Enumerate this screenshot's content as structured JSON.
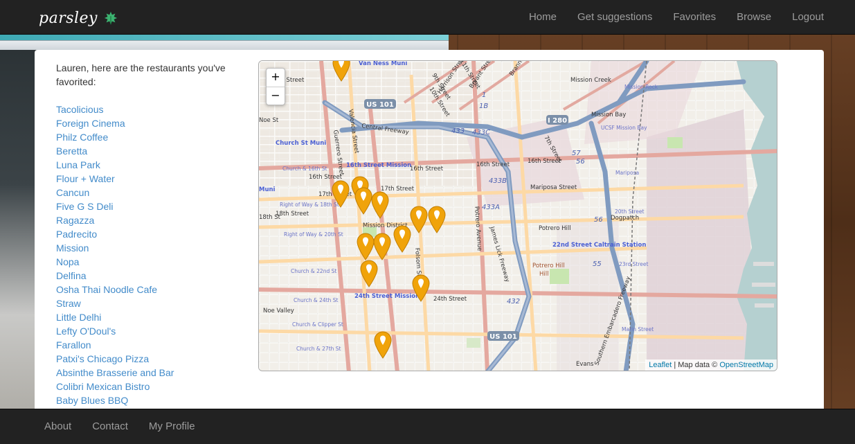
{
  "brand": {
    "name": "parsley",
    "icon": "leaf-icon",
    "accent": "#3cb371"
  },
  "nav": {
    "items": [
      {
        "label": "Home"
      },
      {
        "label": "Get suggestions"
      },
      {
        "label": "Favorites"
      },
      {
        "label": "Browse"
      },
      {
        "label": "Logout"
      }
    ]
  },
  "favorites": {
    "intro": "Lauren, here are the restaurants you've favorited:",
    "restaurants": [
      "Tacolicious",
      "Foreign Cinema",
      "Philz Coffee",
      "Beretta",
      "Luna Park",
      "Flour + Water",
      "Cancun",
      "Five G S Deli",
      "Ragazza",
      "Padrecito",
      "Mission",
      "Nopa",
      "Delfina",
      "Osha Thai Noodle Cafe",
      "Straw",
      "Little Delhi",
      "Lefty O'Doul's",
      "Farallon",
      "Patxi's Chicago Pizza",
      "Absinthe Brasserie and Bar",
      "Colibri Mexican Bistro",
      "Baby Blues BBQ"
    ]
  },
  "map": {
    "zoom_in": "+",
    "zoom_out": "−",
    "attribution_leaflet": "Leaflet",
    "attribution_sep": " | Map data © ",
    "attribution_osm": "OpenStreetMap",
    "marker_color": "#f0a30a",
    "labels": {
      "van_ness_muni": "Van Ness Muni",
      "us101_top": "US 101",
      "central_fwy": "Central Freeway",
      "church_muni": "Church St Muni",
      "church_16th": "Church & 16th St",
      "mission_16th": "16th Street Mission",
      "st_16th_a": "16th Street",
      "st_16th_b": "16th Street",
      "st_16th_c": "16th Street",
      "st_16th_d": "16th Street",
      "st_17th": "17th Street",
      "st_17th_b": "17th Street",
      "st_18th": "18th Street",
      "mission_district": "Mission District",
      "church_22nd": "Church & 22nd St",
      "church_24th": "Church & 24th St",
      "mission_24th": "24th Street Mission",
      "st_24th": "24th Street",
      "noe_valley": "Noe Valley",
      "church_clipper": "Church & Clipper St",
      "church_27th": "Church & 27th St",
      "us101_bottom": "US 101",
      "i280": "I 280",
      "mission_creek": "Mission Creek",
      "mission_bay": "Mission Bay",
      "ucsf": "UCSF Mission Bay",
      "mariposa": "Mariposa Street",
      "potrero_hill": "Potrero Hill",
      "caltrain_22nd": "22nd Street Caltrain Station",
      "dogpatch": "Dogpatch",
      "st_20th": "20th Street",
      "st_23rd": "23rd Street",
      "mariposa_st": "Mariposa",
      "marin": "Marin Street",
      "potrero_ave": "Potrero Avenue",
      "folsom": "Folsom Street",
      "valencia": "Valencia Street",
      "guerrero": "Guerrero Street",
      "james_lick": "James Lick Freeway",
      "row_18th": "Right of Way & 18th St",
      "row_20th": "Right of Way & 20th St",
      "route_433": "433",
      "route_433c": "433C",
      "route_433b": "433B",
      "route_433a": "433A",
      "route_432": "432",
      "route_57": "57",
      "route_56a": "56",
      "route_56b": "56",
      "route_55": "55",
      "route_1": "1",
      "route_1b": "1B",
      "potrero_hill_park": "Potrero Hill",
      "mission_rock": "Mission Rock",
      "st_7th": "7th Street",
      "brannan": "Brannan Street",
      "bryant": "Bryant Street",
      "st_9th": "9th Street",
      "st_10th": "10th Street",
      "harrison": "Harrison Street",
      "st_11th": "11th Street",
      "oak": "Oak Street",
      "noe": "Noe St",
      "st_18th_b": "18th St",
      "muni_left": "Muni",
      "evans": "Evans",
      "southern_emb": "Southern Embarcadero Freeway",
      "hill": "Hill"
    }
  },
  "footer": {
    "items": [
      {
        "label": "About"
      },
      {
        "label": "Contact"
      },
      {
        "label": "My Profile"
      }
    ]
  }
}
